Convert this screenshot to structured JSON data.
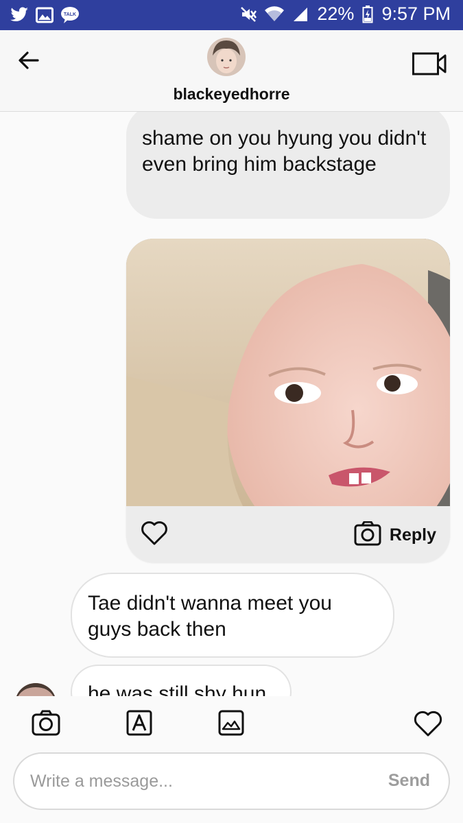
{
  "status_bar": {
    "battery": "22%",
    "time": "9:57 PM",
    "app_icons": [
      "twitter-icon",
      "gallery-icon",
      "talk-icon"
    ],
    "talk_badge": "TALK",
    "system_icons": [
      "mute-icon",
      "wifi-icon",
      "signal-icon",
      "battery-icon"
    ]
  },
  "header": {
    "username": "blackeyedhorre",
    "back_icon": "back-arrow-icon",
    "video_icon": "video-call-icon"
  },
  "messages": [
    {
      "side": "right",
      "text": "shame on you hyung you didn't even bring him backstage"
    },
    {
      "side": "right",
      "type": "image",
      "reply_label": "Reply"
    },
    {
      "side": "left",
      "text": "Tae didn't wanna meet you guys back then"
    },
    {
      "side": "left",
      "text": "he was still shy hun"
    }
  ],
  "toolbar": {
    "icons": [
      "camera-icon",
      "sticker-icon",
      "gallery-icon",
      "heart-icon"
    ]
  },
  "composer": {
    "placeholder": "Write a message...",
    "send_label": "Send"
  },
  "colors": {
    "status_bar": "#2f3f9e",
    "bubble_grey": "#ececec",
    "bubble_white": "#ffffff"
  }
}
